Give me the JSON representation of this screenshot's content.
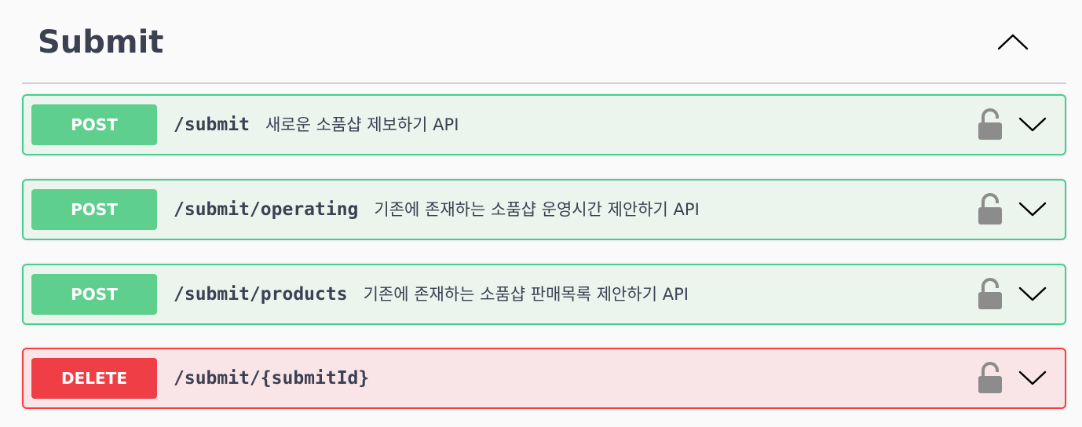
{
  "tag": {
    "title": "Submit",
    "collapse_icon": "chevron-up-icon"
  },
  "operations": [
    {
      "method": "POST",
      "path": "/submit",
      "summary": "새로운 소품샵 제보하기 API",
      "lock_icon": "unlocked-lock-icon",
      "expand_icon": "chevron-down-icon"
    },
    {
      "method": "POST",
      "path": "/submit/operating",
      "summary": "기존에 존재하는 소품샵 운영시간 제안하기 API",
      "lock_icon": "unlocked-lock-icon",
      "expand_icon": "chevron-down-icon"
    },
    {
      "method": "POST",
      "path": "/submit/products",
      "summary": "기존에 존재하는 소품샵 판매목록 제안하기 API",
      "lock_icon": "unlocked-lock-icon",
      "expand_icon": "chevron-down-icon"
    },
    {
      "method": "DELETE",
      "path": "/submit/{submitId}",
      "summary": "",
      "lock_icon": "unlocked-lock-icon",
      "expand_icon": "chevron-down-icon"
    }
  ],
  "colors": {
    "post_border": "#49cc90",
    "post_background": "#ebf5ee",
    "post_badge": "#5fcf8e",
    "delete_border": "#f93e3e",
    "delete_background": "#f9e5e7",
    "delete_badge": "#f03e47",
    "text": "#3b4151",
    "lock_icon": "#8c8c8c"
  }
}
